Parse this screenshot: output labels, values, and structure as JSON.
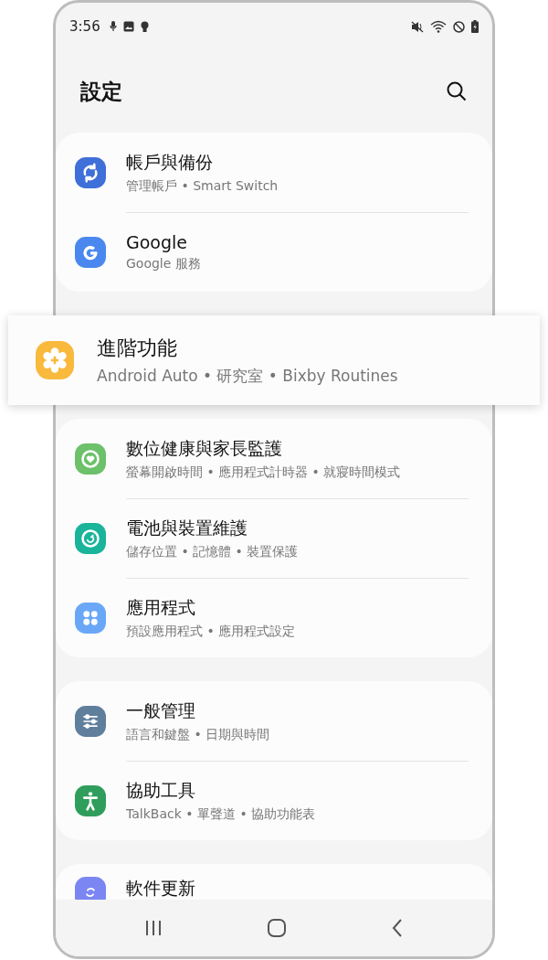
{
  "status_bar": {
    "time": "3:56"
  },
  "header": {
    "title": "設定"
  },
  "groups": [
    {
      "highlighted": false,
      "items": [
        {
          "title": "帳戶與備份",
          "subtitle": "管理帳戶 • Smart Switch",
          "kind": "sync",
          "color": "#3f6fd8"
        },
        {
          "title": "Google",
          "subtitle": "Google 服務",
          "kind": "google",
          "color": "#4a88ef"
        }
      ]
    },
    {
      "highlighted": true,
      "items": [
        {
          "title": "進階功能",
          "subtitle": "Android Auto • 研究室 • Bixby Routines",
          "kind": "gear",
          "color": "#f9b93c"
        }
      ]
    },
    {
      "highlighted": false,
      "items": [
        {
          "title": "數位健康與家長監護",
          "subtitle": "螢幕開啟時間 • 應用程式計時器 • 就寢時間模式",
          "kind": "heart",
          "color": "#6cc16a"
        },
        {
          "title": "電池與裝置維護",
          "subtitle": "儲存位置 • 記憶體 • 裝置保護",
          "kind": "refresh",
          "color": "#19b49a"
        },
        {
          "title": "應用程式",
          "subtitle": "預設應用程式 • 應用程式設定",
          "kind": "apps",
          "color": "#6aa8f7"
        }
      ]
    },
    {
      "highlighted": false,
      "items": [
        {
          "title": "一般管理",
          "subtitle": "語言和鍵盤 • 日期與時間",
          "kind": "sliders",
          "color": "#5f7f9c"
        },
        {
          "title": "協助工具",
          "subtitle": "TalkBack • 單聲道 • 協助功能表",
          "kind": "person",
          "color": "#2f9e5c"
        }
      ]
    },
    {
      "highlighted": false,
      "items": [
        {
          "title": "軟件更新",
          "kind": "update",
          "color": "#7b86f2"
        }
      ]
    }
  ]
}
